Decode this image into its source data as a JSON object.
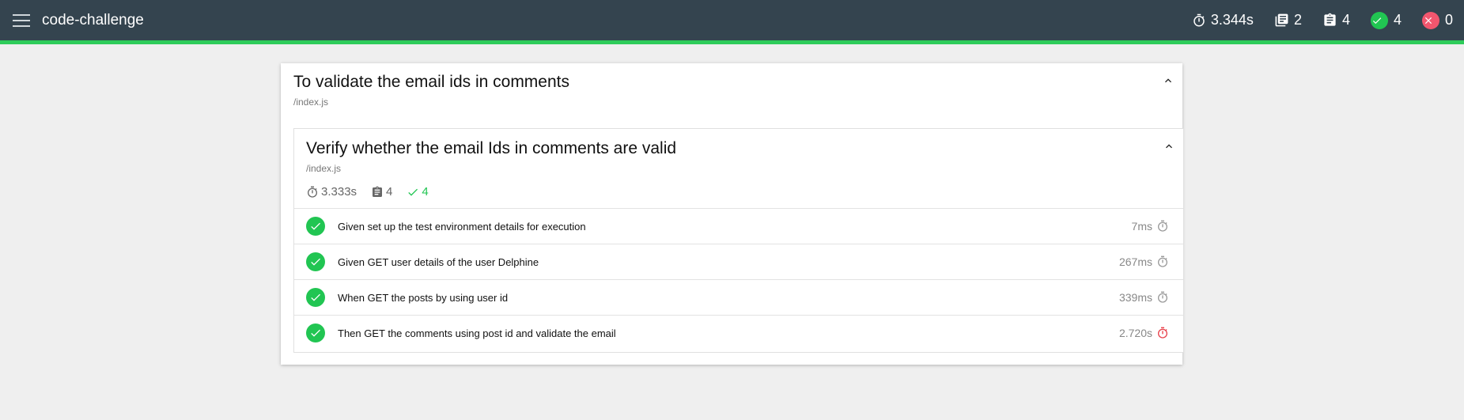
{
  "app": {
    "title": "code-challenge"
  },
  "header_stats": {
    "duration": "3.344s",
    "suites": "2",
    "tests": "4",
    "passed": "4",
    "failed": "0"
  },
  "suite": {
    "title": "To validate the email ids in comments",
    "file": "/index.js"
  },
  "inner_suite": {
    "title": "Verify whether the email Ids in comments are valid",
    "file": "/index.js",
    "duration": "3.333s",
    "tests": "4",
    "passed": "4"
  },
  "tests": [
    {
      "name": "Given set up the test environment details for execution",
      "duration": "7ms"
    },
    {
      "name": "Given GET user details of the user Delphine",
      "duration": "267ms"
    },
    {
      "name": "When GET the posts by using user id",
      "duration": "339ms"
    },
    {
      "name": "Then GET the comments using post id and validate the email",
      "duration": "2.720s"
    }
  ],
  "colors": {
    "header_bg": "#34444f",
    "accent": "#2ecc5a",
    "pass": "#21c552",
    "fail": "#f2566e",
    "slow": "#e8404a"
  }
}
